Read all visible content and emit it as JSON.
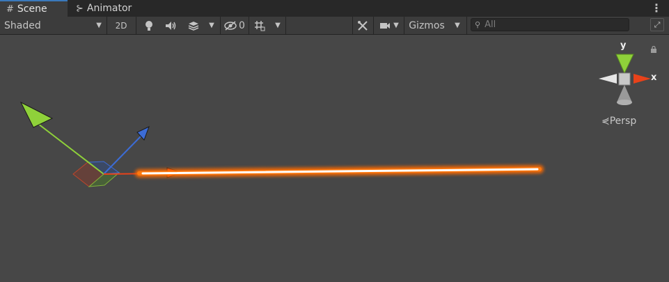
{
  "tabs": [
    {
      "label": "Scene",
      "icon": "grid-icon",
      "active": true
    },
    {
      "label": "Animator",
      "icon": "animator-icon",
      "active": false
    }
  ],
  "toolbar": {
    "shading_mode": "Shaded",
    "mode_2d_label": "2D",
    "hidden_count": "0",
    "gizmos_label": "Gizmos",
    "search_placeholder": "All"
  },
  "scene_gizmo": {
    "y_label": "y",
    "x_label": "x",
    "projection_label": "Persp"
  },
  "colors": {
    "axis_x": "#e8421a",
    "axis_y": "#8fd13a",
    "axis_z": "#3c6cd6",
    "laser_core": "#ffffff",
    "laser_glow": "#ff6a00",
    "tab_accent": "#3a79bb"
  }
}
